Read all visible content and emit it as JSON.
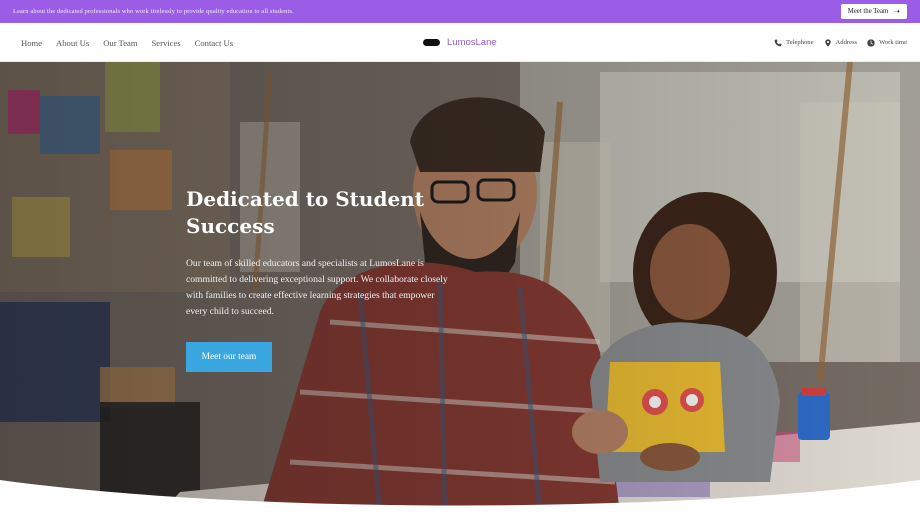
{
  "announcement": {
    "text": "Learn about the dedicated professionals who work tirelessly to provide quality education to all students.",
    "button_label": "Meet the Team",
    "button_icon": "arrow-right-icon"
  },
  "nav": {
    "links": [
      "Home",
      "About Us",
      "Our Team",
      "Services",
      "Contact Us"
    ],
    "brand": "LumosLane",
    "info": [
      {
        "label": "Telephone",
        "icon": "phone-icon"
      },
      {
        "label": "Address",
        "icon": "location-pin-icon"
      },
      {
        "label": "Work time",
        "icon": "clock-icon"
      }
    ]
  },
  "hero": {
    "title": "Dedicated to Student Success",
    "description": "Our team of skilled educators and specialists at LumosLane is committed to delivering exceptional support. We collaborate closely with families to create effective learning strategies that empower every child to succeed.",
    "cta_label": "Meet our team"
  },
  "colors": {
    "announcement_bg": "#9b5de5",
    "brand_text": "#8a5fd3",
    "cta_bg": "#3aa7e0"
  }
}
